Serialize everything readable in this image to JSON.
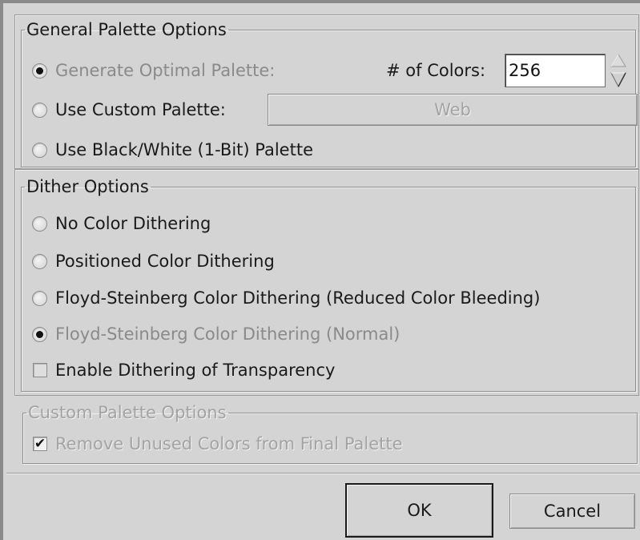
{
  "general": {
    "legend": "General Palette Options",
    "generate_label": "Generate Optimal Palette:",
    "num_colors_label": "# of Colors:",
    "num_colors_value": "256",
    "custom_label": "Use Custom Palette:",
    "custom_palette_button": "Web",
    "bw_label": "Use Black/White (1-Bit) Palette",
    "selected": "generate"
  },
  "dither": {
    "legend": "Dither Options",
    "options": [
      "No Color Dithering",
      "Positioned Color Dithering",
      "Floyd-Steinberg Color Dithering (Reduced Color Bleeding)",
      "Floyd-Steinberg Color Dithering (Normal)"
    ],
    "selected_index": 3,
    "transparency_label": "Enable Dithering of Transparency",
    "transparency_checked": false
  },
  "custom_palette": {
    "legend": "Custom Palette Options",
    "remove_unused_label": "Remove Unused Colors from Final Palette",
    "remove_unused_checked": true
  },
  "buttons": {
    "ok": "OK",
    "cancel": "Cancel"
  }
}
